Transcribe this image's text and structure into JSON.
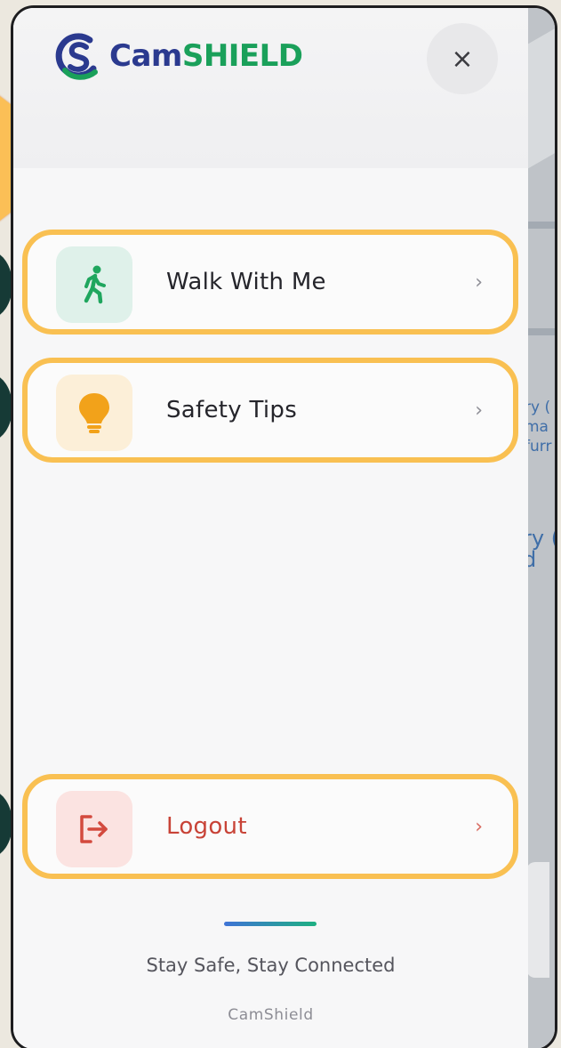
{
  "app": {
    "logo_cam": "Cam",
    "logo_shield": "SHIELD",
    "close_glyph": "×"
  },
  "menu": {
    "items": [
      {
        "label": "Walk With Me",
        "icon": "walking-person-icon",
        "chevron": "›",
        "accent": "#1fa65e",
        "icon_bg": "#dff1ea"
      },
      {
        "label": "Safety Tips",
        "icon": "lightbulb-icon",
        "chevron": "›",
        "accent": "#f2a21a",
        "icon_bg": "#fcefd8"
      }
    ],
    "logout": {
      "label": "Logout",
      "icon": "logout-icon",
      "chevron": "›",
      "accent": "#d34a3e",
      "icon_bg": "#fbe3e1"
    }
  },
  "footer": {
    "tagline": "Stay Safe, Stay Connected",
    "brand": "CamShield"
  },
  "map": {
    "label_a": "ry (\nma\nfurr",
    "label_b": "ry (\nd"
  },
  "colors": {
    "highlight": "#f9c052",
    "brand_blue": "#2b3a8f",
    "brand_green": "#1aa05a"
  }
}
